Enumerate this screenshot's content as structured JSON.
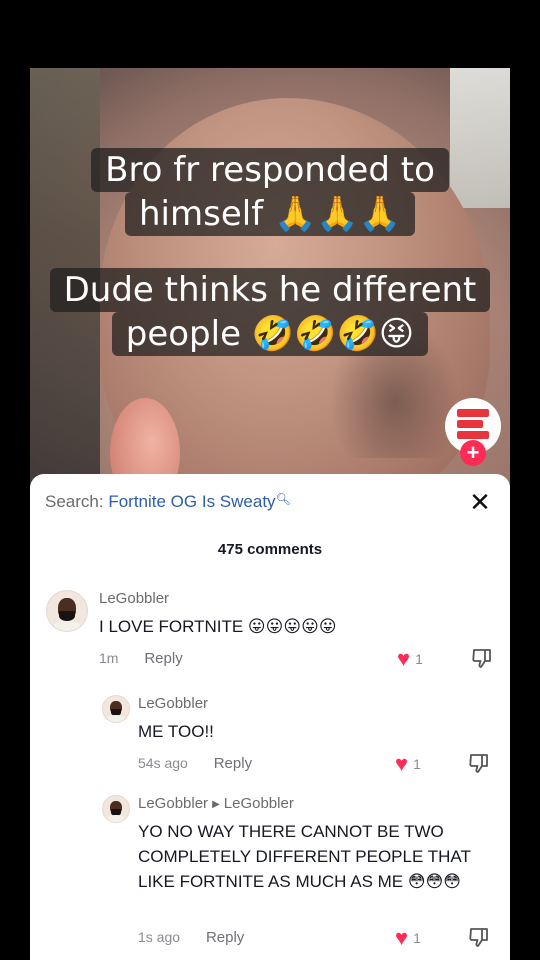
{
  "video": {
    "caption1": {
      "line1": "Bro fr responded to",
      "line2": "himself 🙏🙏🙏"
    },
    "caption2": {
      "line1": "Dude thinks he different",
      "line2": "people 🤣🤣🤣😝"
    },
    "follow_symbol": "+"
  },
  "panel": {
    "search_label": "Search:",
    "search_query": "Fortnite OG Is Sweaty",
    "search_icon": "magnifier-icon",
    "close_symbol": "✕",
    "comment_count": "475 comments"
  },
  "comments": [
    {
      "username": "LeGobbler",
      "text": "I LOVE FORTNITE 😛😛😛😛😛",
      "time": "1m",
      "reply": "Reply",
      "likes": "1"
    },
    {
      "username": "LeGobbler",
      "text": "ME TOO!!",
      "time": "54s ago",
      "reply": "Reply",
      "likes": "1"
    },
    {
      "username": "LeGobbler",
      "reply_to": "LeGobbler",
      "text": "YO NO WAY THERE CANNOT BE TWO COMPLETELY DIFFERENT PEOPLE THAT LIKE FORTNITE AS MUCH AS ME 😳😳😳",
      "time": "1s ago",
      "reply": "Reply",
      "likes": "1"
    }
  ],
  "colors": {
    "like_heart": "#fe2c55",
    "search_query": "#2f5ea8",
    "follow_badge": "#fe2c55"
  }
}
